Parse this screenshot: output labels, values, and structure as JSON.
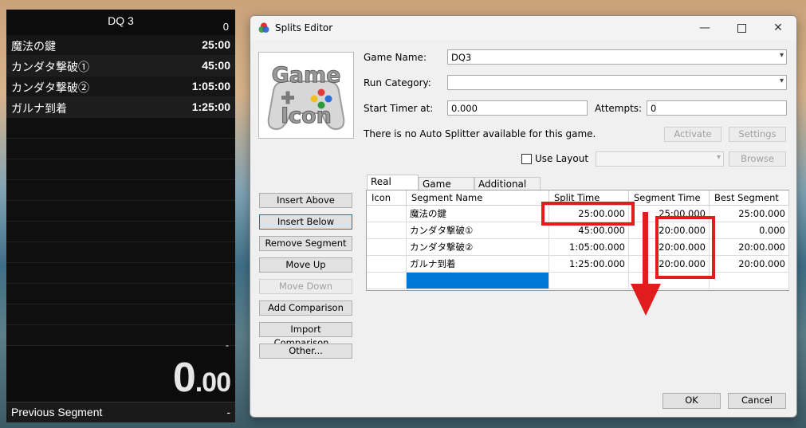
{
  "livesplit": {
    "title": "DQ 3",
    "attempts": "0",
    "segments": [
      {
        "name": "魔法の鍵",
        "time": "25:00"
      },
      {
        "name": "カンダタ撃破①",
        "time": "45:00"
      },
      {
        "name": "カンダタ撃破②",
        "time": "1:05:00"
      },
      {
        "name": "ガルナ到着",
        "time": "1:25:00"
      }
    ],
    "timer_dash": "-",
    "timer_main": "0",
    "timer_decimal": ".00",
    "previous_segment_label": "Previous Segment",
    "previous_segment_value": "-"
  },
  "editor": {
    "title": "Splits Editor",
    "window_buttons": {
      "minimize": "—",
      "close": "✕"
    },
    "game_icon_text_top": "Game",
    "game_icon_text_bottom": "Icon",
    "game_name_label": "Game Name:",
    "game_name_value": "DQ3",
    "run_category_label": "Run Category:",
    "run_category_value": "",
    "start_timer_label": "Start Timer at:",
    "start_timer_value": "0.000",
    "attempts_label": "Attempts:",
    "attempts_value": "0",
    "auto_splitter_text": "There is no Auto Splitter available for this game.",
    "activate_label": "Activate",
    "settings_label": "Settings",
    "use_layout_label": "Use Layout",
    "browse_label": "Browse",
    "left_buttons": {
      "insert_above": "Insert Above",
      "insert_below": "Insert Below",
      "remove_segment": "Remove Segment",
      "move_up": "Move Up",
      "move_down": "Move Down",
      "add_comparison": "Add Comparison",
      "import_comparison": "Import Comparison...",
      "other": "Other..."
    },
    "tabs": {
      "real_time": "Real Time",
      "game_time": "Game Time",
      "additional_info": "Additional Info"
    },
    "columns": {
      "icon": "Icon",
      "segment_name": "Segment Name",
      "split_time": "Split Time",
      "segment_time": "Segment Time",
      "best_segment": "Best Segment"
    },
    "rows": [
      {
        "name": "魔法の鍵",
        "split": "25:00.000",
        "segment": "25:00.000",
        "best": "25:00.000"
      },
      {
        "name": "カンダタ撃破①",
        "split": "45:00.000",
        "segment": "20:00.000",
        "best": "0.000"
      },
      {
        "name": "カンダタ撃破②",
        "split": "1:05:00.000",
        "segment": "20:00.000",
        "best": "20:00.000"
      },
      {
        "name": "ガルナ到着",
        "split": "1:25:00.000",
        "segment": "20:00.000",
        "best": "20:00.000"
      }
    ],
    "ok_label": "OK",
    "cancel_label": "Cancel"
  },
  "colors": {
    "annotation_red": "#e01c1c",
    "selection_blue": "#0078d7"
  }
}
